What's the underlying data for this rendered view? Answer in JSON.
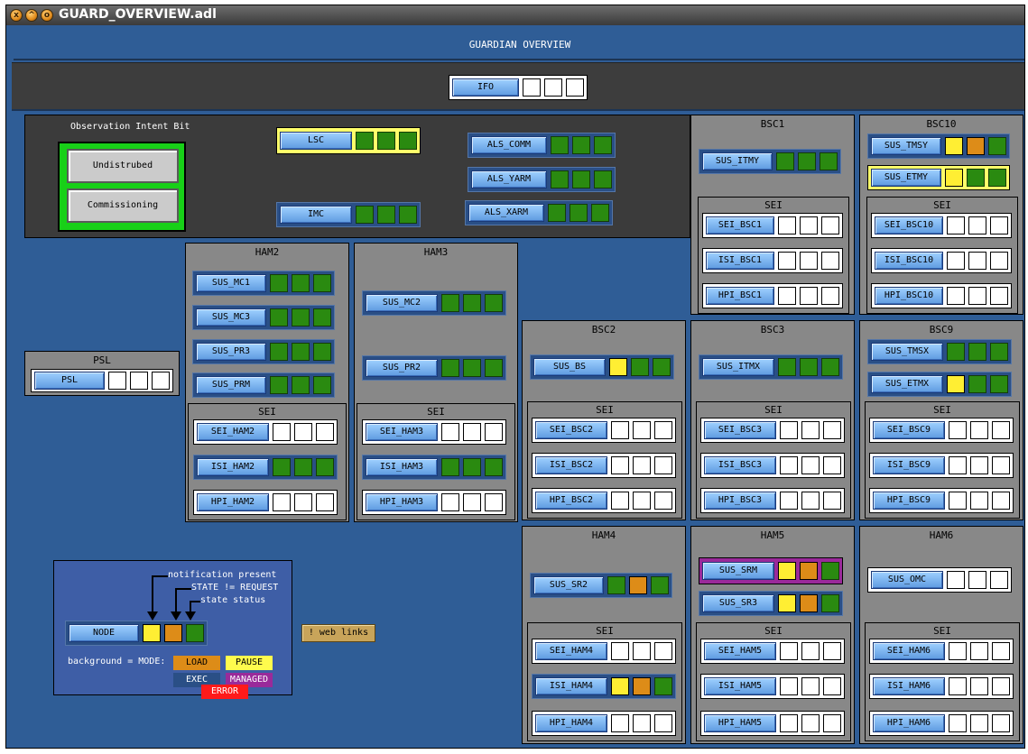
{
  "window": {
    "title": "GUARD_OVERVIEW.adl",
    "buttons": [
      "x",
      "^",
      "o"
    ]
  },
  "header": {
    "title": "GUARDIAN OVERVIEW"
  },
  "ifo": {
    "label": "IFO"
  },
  "oib": {
    "title": "Observation Intent Bit",
    "undisturbed": "Undistrubed",
    "commissioning": "Commissioning"
  },
  "groups": {
    "lsc": "LSC",
    "imc": "IMC",
    "als_comm": "ALS_COMM",
    "als_yarm": "ALS_YARM",
    "als_xarm": "ALS_XARM",
    "bsc1": "BSC1",
    "bsc10": "BSC10",
    "ham2": "HAM2",
    "ham3": "HAM3",
    "bsc2": "BSC2",
    "bsc3": "BSC3",
    "bsc9": "BSC9",
    "ham4": "HAM4",
    "ham5": "HAM5",
    "ham6": "HAM6",
    "psl": "PSL",
    "sei": "SEI"
  },
  "nodes": {
    "sus_itmy": "SUS_ITMY",
    "sus_tmsy": "SUS_TMSY",
    "sus_etmy": "SUS_ETMY",
    "sei_bsc1": "SEI_BSC1",
    "isi_bsc1": "ISI_BSC1",
    "hpi_bsc1": "HPI_BSC1",
    "sei_bsc10": "SEI_BSC10",
    "isi_bsc10": "ISI_BSC10",
    "hpi_bsc10": "HPI_BSC10",
    "sus_mc1": "SUS_MC1",
    "sus_mc3": "SUS_MC3",
    "sus_pr3": "SUS_PR3",
    "sus_prm": "SUS_PRM",
    "sei_ham2": "SEI_HAM2",
    "isi_ham2": "ISI_HAM2",
    "hpi_ham2": "HPI_HAM2",
    "sus_mc2": "SUS_MC2",
    "sus_pr2": "SUS_PR2",
    "sei_ham3": "SEI_HAM3",
    "isi_ham3": "ISI_HAM3",
    "hpi_ham3": "HPI_HAM3",
    "sus_bs": "SUS_BS",
    "sei_bsc2": "SEI_BSC2",
    "isi_bsc2": "ISI_BSC2",
    "hpi_bsc2": "HPI_BSC2",
    "sus_itmx": "SUS_ITMX",
    "sei_bsc3": "SEI_BSC3",
    "isi_bsc3": "ISI_BSC3",
    "hpi_bsc3": "HPI_BSC3",
    "sus_tmsx": "SUS_TMSX",
    "sus_etmx": "SUS_ETMX",
    "sei_bsc9": "SEI_BSC9",
    "isi_bsc9": "ISI_BSC9",
    "hpi_bsc9": "HPI_BSC9",
    "sus_sr2": "SUS_SR2",
    "sei_ham4": "SEI_HAM4",
    "isi_ham4": "ISI_HAM4",
    "hpi_ham4": "HPI_HAM4",
    "sus_srm": "SUS_SRM",
    "sus_sr3": "SUS_SR3",
    "sei_ham5": "SEI_HAM5",
    "isi_ham5": "ISI_HAM5",
    "hpi_ham5": "HPI_HAM5",
    "sus_omc": "SUS_OMC",
    "sei_ham6": "SEI_HAM6",
    "isi_ham6": "ISI_HAM6",
    "hpi_ham6": "HPI_HAM6",
    "psl": "PSL"
  },
  "legend": {
    "node": "NODE",
    "notification": "notification present",
    "state_request": "STATE != REQUEST",
    "state_status": "state status",
    "background_mode": "background = MODE:",
    "load": "LOAD",
    "pause": "PAUSE",
    "exec": "EXEC",
    "managed": "MANAGED",
    "error": "ERROR"
  },
  "web_links": "! web links",
  "colors": {
    "green": "#2a8a10",
    "yellow": "#ffee33",
    "orange": "#dd8c18",
    "blue": "#2f5d96",
    "managed": "#9a2a9a",
    "error": "#ff1a1a"
  }
}
